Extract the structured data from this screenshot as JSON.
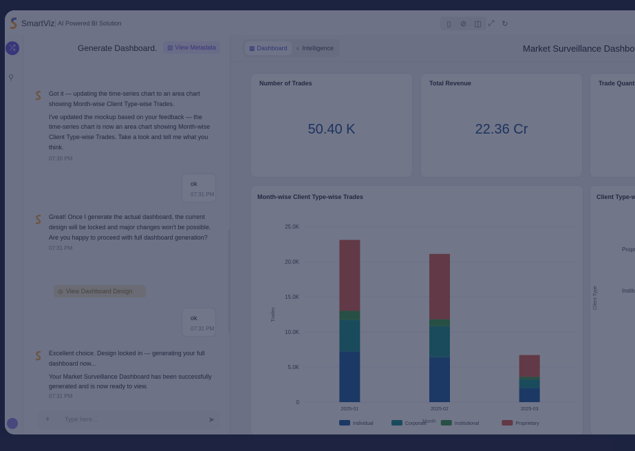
{
  "app": {
    "name": "SmartViz",
    "tagline": "AI Powered BI Solution"
  },
  "window_controls": [
    "sidebar-left-icon",
    "hide-panel-icon",
    "split-view-icon",
    "expand-icon",
    "refresh-icon"
  ],
  "chat": {
    "title": "Generate Dashboard.",
    "metadata_button": "View Metadata",
    "messages": [
      {
        "role": "bot",
        "lead": "Got it — updating the time-series chart to an area chart showing Month-wise Client Type-wise Trades.",
        "body": "I've updated the mockup based on your feedback — the time-series chart is now an area chart showing Month-wise Client Type-wise Trades. Take a look and tell me what you think.",
        "time": "07:30 PM"
      },
      {
        "role": "user",
        "text": "ok",
        "time": "07:31 PM"
      },
      {
        "role": "bot",
        "lead": "Great! Once I generate the actual dashboard, the current design will be locked and major changes won't be possible.",
        "body": "Are you happy to proceed with full dashboard generation?",
        "time": "07:31 PM"
      },
      {
        "role": "user",
        "text": "ok",
        "time": "07:31 PM"
      },
      {
        "role": "bot",
        "lead": "Excellent choice. Design locked in — generating your full dashboard now...",
        "body": "Your Market Surveillance Dashboard has been successfully generated and is now ready to view.",
        "time": "07:31 PM"
      }
    ],
    "design_button": "View Dashboard Design",
    "input_placeholder": "Type here..."
  },
  "dashboard": {
    "tabs": [
      {
        "label": "Dashboard",
        "active": true
      },
      {
        "label": "Intelligence",
        "active": false
      }
    ],
    "title": "Market Surveillance Dashboard",
    "kpis": [
      {
        "label": "Number of Trades",
        "value": "50.40 K"
      },
      {
        "label": "Total Revenue",
        "value": "22.36 Cr"
      },
      {
        "label": "Trade Quantity",
        "value": ""
      }
    ],
    "side_chart": {
      "title": "Client Type-wise",
      "labels": [
        "Proprietary",
        "Institutional"
      ],
      "axis_label": "Client Type"
    }
  },
  "chart_data": {
    "type": "bar",
    "stacked": true,
    "title": "Month-wise Client Type-wise Trades",
    "ylabel": "Trades",
    "xlabel": "Month",
    "ylim": [
      0,
      25000
    ],
    "yticks": [
      "0",
      "5.0K",
      "10.0K",
      "15.0K",
      "20.0K",
      "25.0K"
    ],
    "categories": [
      "2025-01",
      "2025-02",
      "2025-03"
    ],
    "series": [
      {
        "name": "Individual",
        "color": "#1d5fa0",
        "values": [
          7200,
          6400,
          2000
        ]
      },
      {
        "name": "Corporate",
        "color": "#1a8f8a",
        "values": [
          4500,
          4400,
          1200
        ]
      },
      {
        "name": "Institutional",
        "color": "#3a9a4a",
        "values": [
          1300,
          1000,
          400
        ]
      },
      {
        "name": "Proprietary",
        "color": "#d65f4f",
        "values": [
          10100,
          9300,
          3100
        ]
      }
    ]
  }
}
